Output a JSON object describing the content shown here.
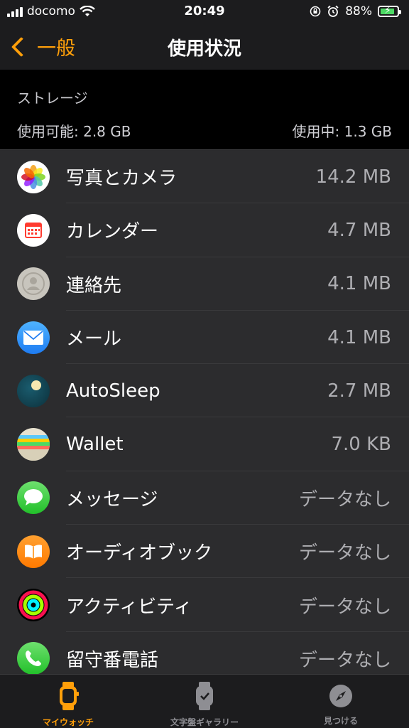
{
  "status_bar": {
    "carrier": "docomo",
    "time": "20:49",
    "battery_percent": "88%",
    "battery_level": 0.88
  },
  "nav": {
    "back_label": "一般",
    "title": "使用状況"
  },
  "storage": {
    "title": "ストレージ",
    "available": "使用可能: 2.8 GB",
    "used": "使用中: 1.3 GB"
  },
  "apps": [
    {
      "name": "写真とカメラ",
      "size": "14.2 MB",
      "icon": "photos-icon"
    },
    {
      "name": "カレンダー",
      "size": "4.7 MB",
      "icon": "calendar-icon"
    },
    {
      "name": "連絡先",
      "size": "4.1 MB",
      "icon": "contacts-icon"
    },
    {
      "name": "メール",
      "size": "4.1 MB",
      "icon": "mail-icon"
    },
    {
      "name": "AutoSleep",
      "size": "2.7 MB",
      "icon": "autosleep-icon"
    },
    {
      "name": "Wallet",
      "size": "7.0 KB",
      "icon": "wallet-icon"
    },
    {
      "name": "メッセージ",
      "size": "データなし",
      "icon": "messages-icon"
    },
    {
      "name": "オーディオブック",
      "size": "データなし",
      "icon": "audiobooks-icon"
    },
    {
      "name": "アクティビティ",
      "size": "データなし",
      "icon": "activity-icon"
    },
    {
      "name": "留守番電話",
      "size": "データなし",
      "icon": "voicemail-icon"
    }
  ],
  "tabs": [
    {
      "label": "マイウォッチ",
      "icon": "watch-icon",
      "active": true
    },
    {
      "label": "文字盤ギャラリー",
      "icon": "watch-face-icon",
      "active": false
    },
    {
      "label": "見つける",
      "icon": "compass-icon",
      "active": false
    }
  ],
  "colors": {
    "accent": "#ff9f0a",
    "background": "#1c1c1e",
    "list_background": "#2c2c2e"
  }
}
